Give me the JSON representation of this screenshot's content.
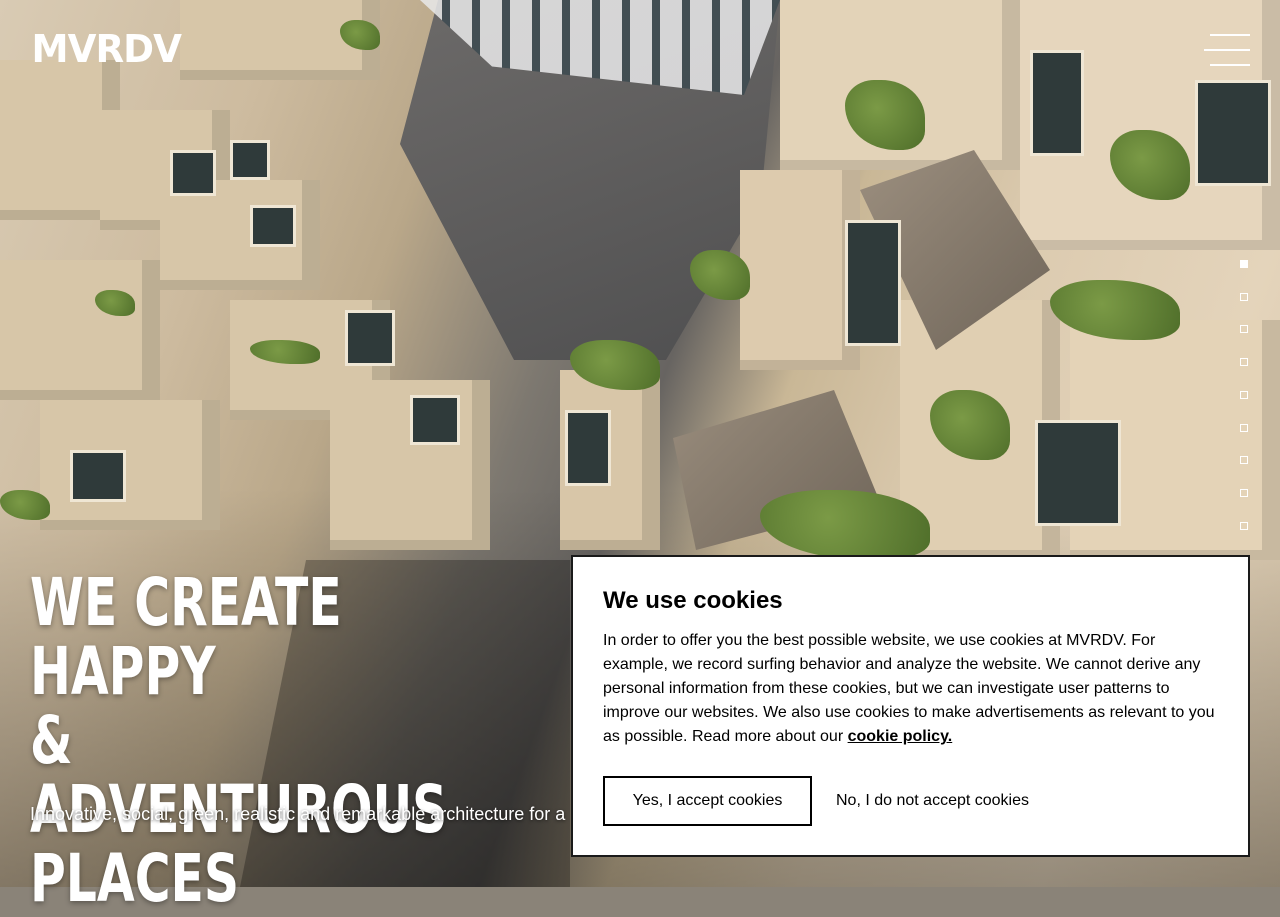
{
  "header": {
    "logo_text": "MVRDV",
    "menu_icon": "hamburger-menu-icon"
  },
  "slider": {
    "slide_count": 9,
    "active_index": 0
  },
  "hero": {
    "headline_lines": [
      "WE CREATE HAPPY",
      "& ADVENTUROUS",
      "PLACES"
    ],
    "subline": "Innovative, social, green, realistic and remarkable architecture for a"
  },
  "cookie_banner": {
    "title": "We use cookies",
    "body": "In order to offer you the best possible website, we use cookies at MVRDV. For example, we record surfing behavior and analyze the website. We cannot derive any personal information from these cookies, but we can investigate user patterns to improve our websites. We also use cookies to make advertisements as relevant to you as possible. Read more about our ",
    "policy_link": "cookie policy.",
    "accept_label": "Yes, I accept cookies",
    "decline_label": "No, I do not accept cookies"
  }
}
